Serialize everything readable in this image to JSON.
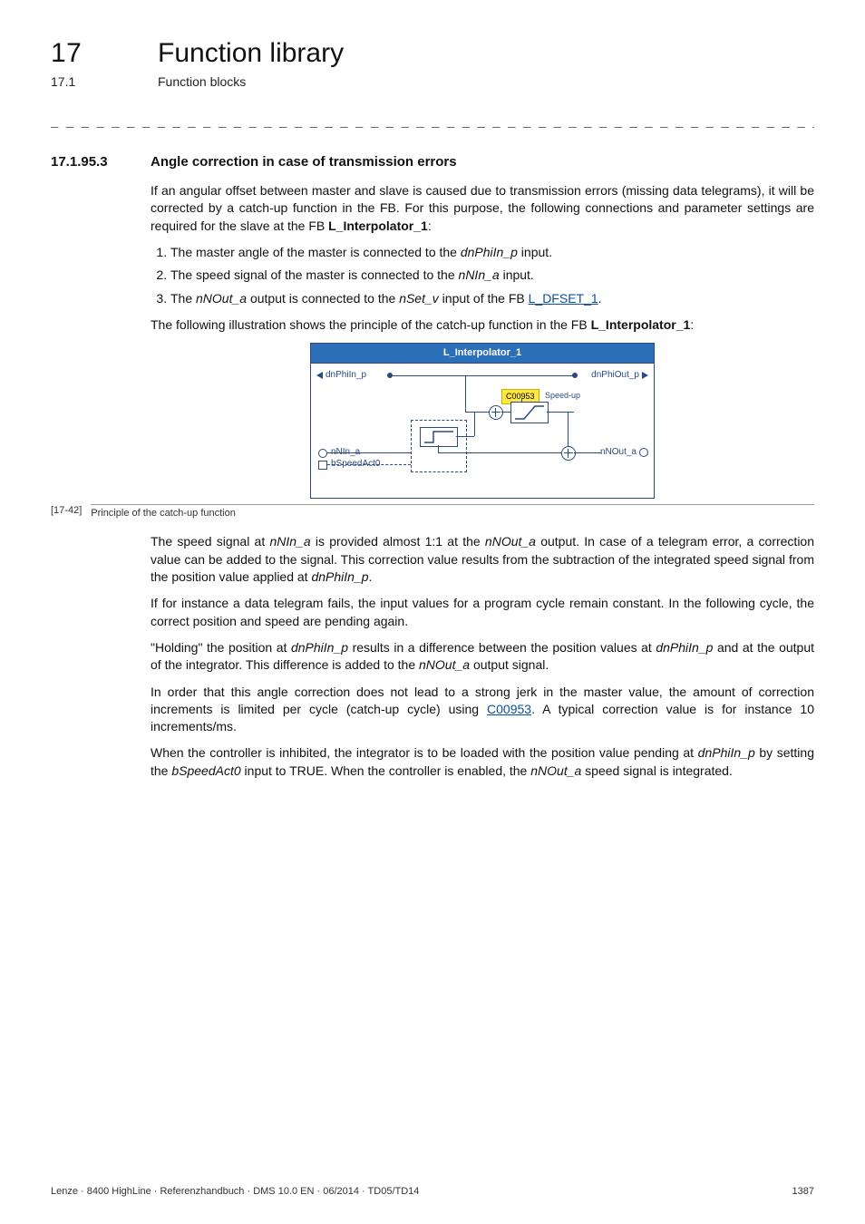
{
  "chapter": {
    "num": "17",
    "title": "Function library"
  },
  "section": {
    "num": "17.1",
    "title": "Function blocks"
  },
  "dashes": "_ _ _ _ _ _ _ _ _ _ _ _ _ _ _ _ _ _ _ _ _ _ _ _ _ _ _ _ _ _ _ _ _ _ _ _ _ _ _ _ _ _ _ _ _ _ _ _ _ _ _ _ _ _ _ _ _ _ _ _ _ _ _ _",
  "h3": {
    "num": "17.1.95.3",
    "title": "Angle correction in case of transmission errors"
  },
  "intro": {
    "p1a": "If an angular offset between master and slave is caused due to transmission errors (missing data telegrams), it will be corrected by a catch-up function in the FB. For this purpose, the following connections and parameter settings are required for the slave at the FB ",
    "p1b": "L_Interpolator_1",
    "p1c": ":"
  },
  "list": {
    "i1a": "The master angle of the master is connected to the ",
    "i1b": "dnPhiIn_p",
    "i1c": " input.",
    "i2a": "The speed signal of the master is connected to the ",
    "i2b": "nNIn_a",
    "i2c": " input.",
    "i3a": "The ",
    "i3b": "nNOut_a",
    "i3c": " output is connected to the ",
    "i3d": "nSet_v",
    "i3e": " input of the FB ",
    "i3link": "L_DFSET_1",
    "i3f": "."
  },
  "lead2a": "The following illustration shows the principle of the catch-up function in the FB ",
  "lead2b": "L_Interpolator_1",
  "lead2c": ":",
  "diagram": {
    "title": "L_Interpolator_1",
    "dnPhiIn": "dnPhiIn_p",
    "dnPhiOut": "dnPhiOut_p",
    "nNIn": "nNIn_a",
    "bSpeedAct0": "bSpeedAct0",
    "nNOut": "nNOut_a",
    "tag": "C00953",
    "speedup": "Speed-up"
  },
  "caption": {
    "tag": "[17-42]",
    "text": "Principle of the catch-up function"
  },
  "post": {
    "p1a": "The speed signal at ",
    "p1b": "nNIn_a",
    "p1c": " is provided almost 1:1 at the ",
    "p1d": "nNOut_a",
    "p1e": " output. In case of a telegram error, a correction value can be added to the signal. This correction value results from the subtraction of the integrated speed signal from the position value applied at ",
    "p1f": "dnPhiIn_p",
    "p1g": ".",
    "p2": "If for instance a data telegram fails, the input values for a program cycle remain constant. In the following cycle, the correct position and speed are pending again.",
    "p3a": "\"Holding\" the position at ",
    "p3b": "dnPhiIn_p",
    "p3c": " results in a difference between the position values at ",
    "p3d": "dnPhiIn_p",
    "p3e": " and at the output of the integrator. This difference is added to the ",
    "p3f": "nNOut_a",
    "p3g": " output signal.",
    "p4a": "In order that this angle correction does not lead to a strong jerk in the master value, the amount of correction increments is limited per cycle (catch-up cycle) using ",
    "p4link": "C00953",
    "p4b": ". A typical correction value is for instance 10 increments/ms.",
    "p5a": "When the controller is inhibited, the integrator is to be loaded with the position value pending at ",
    "p5b": "dnPhiIn_p",
    "p5c": "  by setting the ",
    "p5d": "bSpeedAct0",
    "p5e": " input to TRUE. When the controller is enabled, the ",
    "p5f": "nNOut_a",
    "p5g": " speed signal is integrated."
  },
  "footer": {
    "left": "Lenze · 8400 HighLine · Referenzhandbuch · DMS 10.0 EN · 06/2014 · TD05/TD14",
    "right": "1387"
  }
}
